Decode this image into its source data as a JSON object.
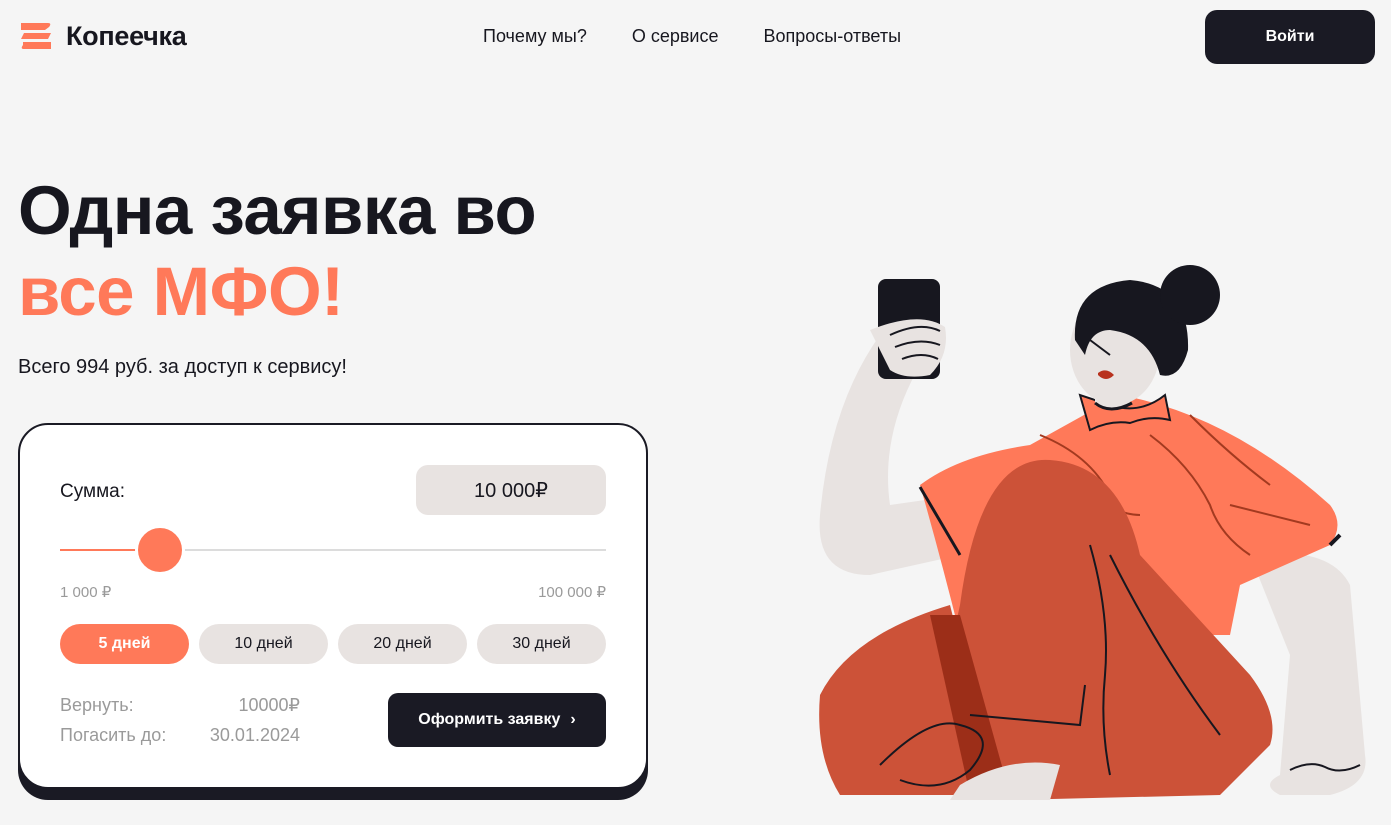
{
  "header": {
    "logo_text": "Копеечка",
    "nav": [
      "Почему мы?",
      "О сервисе",
      "Вопросы-ответы"
    ],
    "login_label": "Войти"
  },
  "hero": {
    "title_line1": "Одна заявка во",
    "title_line2": "все МФО!",
    "subtitle": "Всего 994 руб. за доступ к сервису!"
  },
  "calculator": {
    "sum_label": "Сумма:",
    "sum_value": "10 000₽",
    "slider": {
      "min": 1000,
      "max": 100000,
      "value": 10000
    },
    "range_min_label": "1 000 ₽",
    "range_max_label": "100 000 ₽",
    "days": [
      {
        "label": "5 дней",
        "active": true
      },
      {
        "label": "10 дней",
        "active": false
      },
      {
        "label": "20 дней",
        "active": false
      },
      {
        "label": "30 дней",
        "active": false
      }
    ],
    "return_label": "Вернуть:",
    "return_value": "10000₽",
    "due_label": "Погасить до:",
    "due_value": "30.01.2024",
    "apply_label": "Оформить заявку",
    "apply_icon": "chevron-right-icon"
  },
  "colors": {
    "accent": "#ff7959",
    "dark": "#1a1a24",
    "background": "#f5f5f5",
    "chip": "#e8e3e1"
  }
}
